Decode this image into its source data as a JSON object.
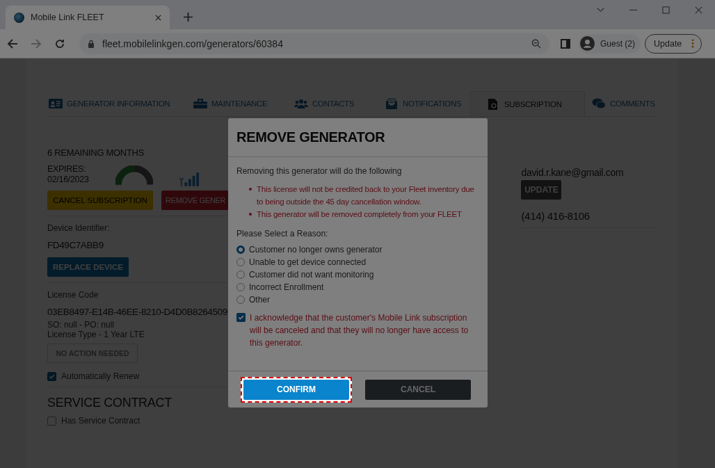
{
  "browser": {
    "tab_title": "Mobile Link FLEET",
    "url": "fleet.mobilelinkgen.com/generators/60384",
    "profile": "Guest (2)",
    "update": "Update"
  },
  "tabs": [
    {
      "label": "GENERATOR INFORMATION",
      "selected": false
    },
    {
      "label": "MAINTENANCE",
      "selected": false
    },
    {
      "label": "CONTACTS",
      "selected": false
    },
    {
      "label": "NOTIFICATIONS",
      "selected": false
    },
    {
      "label": "SUBSCRIPTION",
      "selected": true
    },
    {
      "label": "COMMENTS",
      "selected": false
    }
  ],
  "subscription": {
    "remaining": "6 REMAINING MONTHS",
    "expires": "EXPIRES: 02/16/2023",
    "level": 0.5,
    "cancel_button": "CANCEL SUBSCRIPTION",
    "remove_button": "REMOVE GENER",
    "device_label": "Device Identifier:",
    "device_id": "FD49C7ABB9",
    "replace_button": "REPLACE DEVICE",
    "license_label": "License Code",
    "license_code": "03EB8497-E14B-46EE-8210-D4D0B8264509",
    "so_po": "SO: null - PO: null",
    "license_type": "License Type - 1 Year LTE",
    "action_button": "NO ACTION NEEDED",
    "auto_renew": {
      "label": "Automatically Renew",
      "checked": true
    }
  },
  "service_contract": {
    "title": "SERVICE CONTRACT",
    "has_contract": {
      "label": "Has Service Contract",
      "checked": false
    }
  },
  "contact": {
    "email": "david.r.kane@gmail.com",
    "update_button": "UPDATE",
    "phone": "(414) 416-8106"
  },
  "modal": {
    "title": "REMOVE GENERATOR",
    "intro": "Removing this generator will do the following",
    "warnings": [
      "This license will not be credited back to your Fleet inventory due to being outside the 45 day cancellation window.",
      "This generator will be removed completely from your FLEET"
    ],
    "reason_label": "Please Select a Reason:",
    "reasons": [
      {
        "label": "Customer no longer owns generator",
        "selected": true
      },
      {
        "label": "Unable to get device connected",
        "selected": false
      },
      {
        "label": "Customer did not want monitoring",
        "selected": false
      },
      {
        "label": "Incorrect Enrollment",
        "selected": false
      },
      {
        "label": "Other",
        "selected": false
      }
    ],
    "acknowledge": {
      "label": "I acknowledge that the customer's Mobile Link subscription will be canceled and that they will no longer have access to this generator.",
      "checked": true
    },
    "confirm": "CONFIRM",
    "cancel": "CANCEL"
  }
}
